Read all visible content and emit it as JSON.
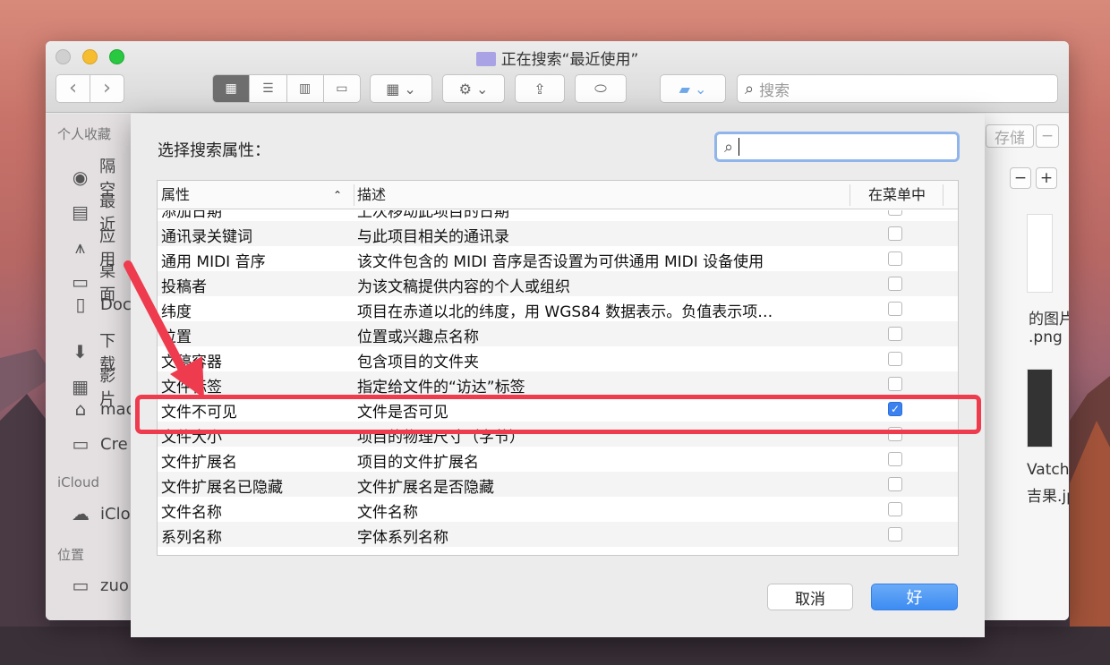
{
  "window": {
    "title": "正在搜索“最近使用”",
    "search_placeholder": "搜索"
  },
  "sidebar": {
    "favorites_header": "个人收藏",
    "items": [
      {
        "label": "隔空",
        "icon": "airdrop-icon"
      },
      {
        "label": "最近",
        "icon": "recents-icon"
      },
      {
        "label": "应用",
        "icon": "applications-icon"
      },
      {
        "label": "桌面",
        "icon": "desktop-icon"
      },
      {
        "label": "Doc",
        "icon": "documents-icon"
      },
      {
        "label": "下载",
        "icon": "downloads-icon"
      },
      {
        "label": "影片",
        "icon": "movies-icon"
      },
      {
        "label": "mac",
        "icon": "home-icon"
      },
      {
        "label": "Cre",
        "icon": "folder-icon"
      }
    ],
    "icloud_header": "iCloud",
    "icloud_item": "iClo",
    "locations_header": "位置",
    "locations_item": "zuo"
  },
  "right_panel": {
    "save_label": "存储",
    "file1_line1": "的图片",
    "file1_line2": ".png",
    "file2_line1": "Vatch",
    "file2_line2": "吉果.jpg"
  },
  "dialog": {
    "title": "选择搜索属性：",
    "search_value": "",
    "columns": {
      "attr": "属性",
      "desc": "描述",
      "menu": "在菜单中"
    },
    "rows": [
      {
        "attr": "添加日期",
        "desc": "上次移动此项目的日期",
        "checked": false
      },
      {
        "attr": "通讯录关键词",
        "desc": "与此项目相关的通讯录",
        "checked": false
      },
      {
        "attr": "通用 MIDI 音序",
        "desc": "该文件包含的 MIDI 音序是否设置为可供通用 MIDI 设备使用",
        "checked": false
      },
      {
        "attr": "投稿者",
        "desc": "为该文稿提供内容的个人或组织",
        "checked": false
      },
      {
        "attr": "纬度",
        "desc": "项目在赤道以北的纬度，用 WGS84 数据表示。负值表示项…",
        "checked": false
      },
      {
        "attr": "位置",
        "desc": "位置或兴趣点名称",
        "checked": false
      },
      {
        "attr": "文稿容器",
        "desc": "包含项目的文件夹",
        "checked": false
      },
      {
        "attr": "文件标签",
        "desc": "指定给文件的“访达”标签",
        "checked": false
      },
      {
        "attr": "文件不可见",
        "desc": "文件是否可见",
        "checked": true
      },
      {
        "attr": "文件大小",
        "desc": "项目的物理尺寸（字节）",
        "checked": false
      },
      {
        "attr": "文件扩展名",
        "desc": "项目的文件扩展名",
        "checked": false
      },
      {
        "attr": "文件扩展名已隐藏",
        "desc": "文件扩展名是否隐藏",
        "checked": false
      },
      {
        "attr": "文件名称",
        "desc": "文件名称",
        "checked": false
      },
      {
        "attr": "系列名称",
        "desc": "字体系列名称",
        "checked": false
      }
    ],
    "cancel_label": "取消",
    "ok_label": "好"
  },
  "colors": {
    "highlight": "#ee3b4d",
    "accent": "#3d8cf2"
  }
}
